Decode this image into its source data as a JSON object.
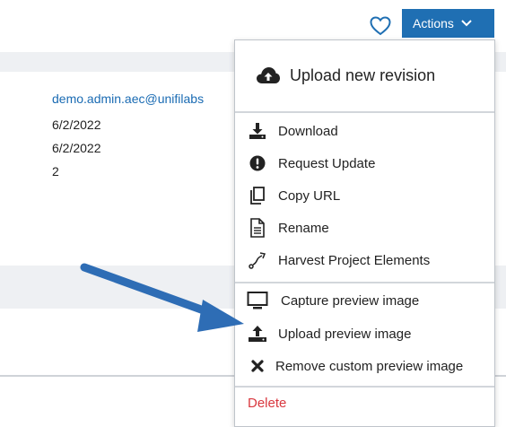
{
  "details": {
    "email": "demo.admin.aec@unifilabs",
    "created": "6/2/2022",
    "modified": "6/2/2022",
    "count": "2"
  },
  "header": {
    "actions_label": "Actions"
  },
  "menu": {
    "upload_revision": "Upload new revision",
    "download": "Download",
    "request_update": "Request Update",
    "copy_url": "Copy URL",
    "rename": "Rename",
    "harvest": "Harvest Project Elements",
    "capture_preview": "Capture preview image",
    "upload_preview": "Upload preview image",
    "remove_preview": "Remove custom preview image",
    "delete": "Delete"
  },
  "colors": {
    "accent": "#1f6fb3",
    "danger": "#d9383f",
    "arrow": "#2e6db5"
  }
}
